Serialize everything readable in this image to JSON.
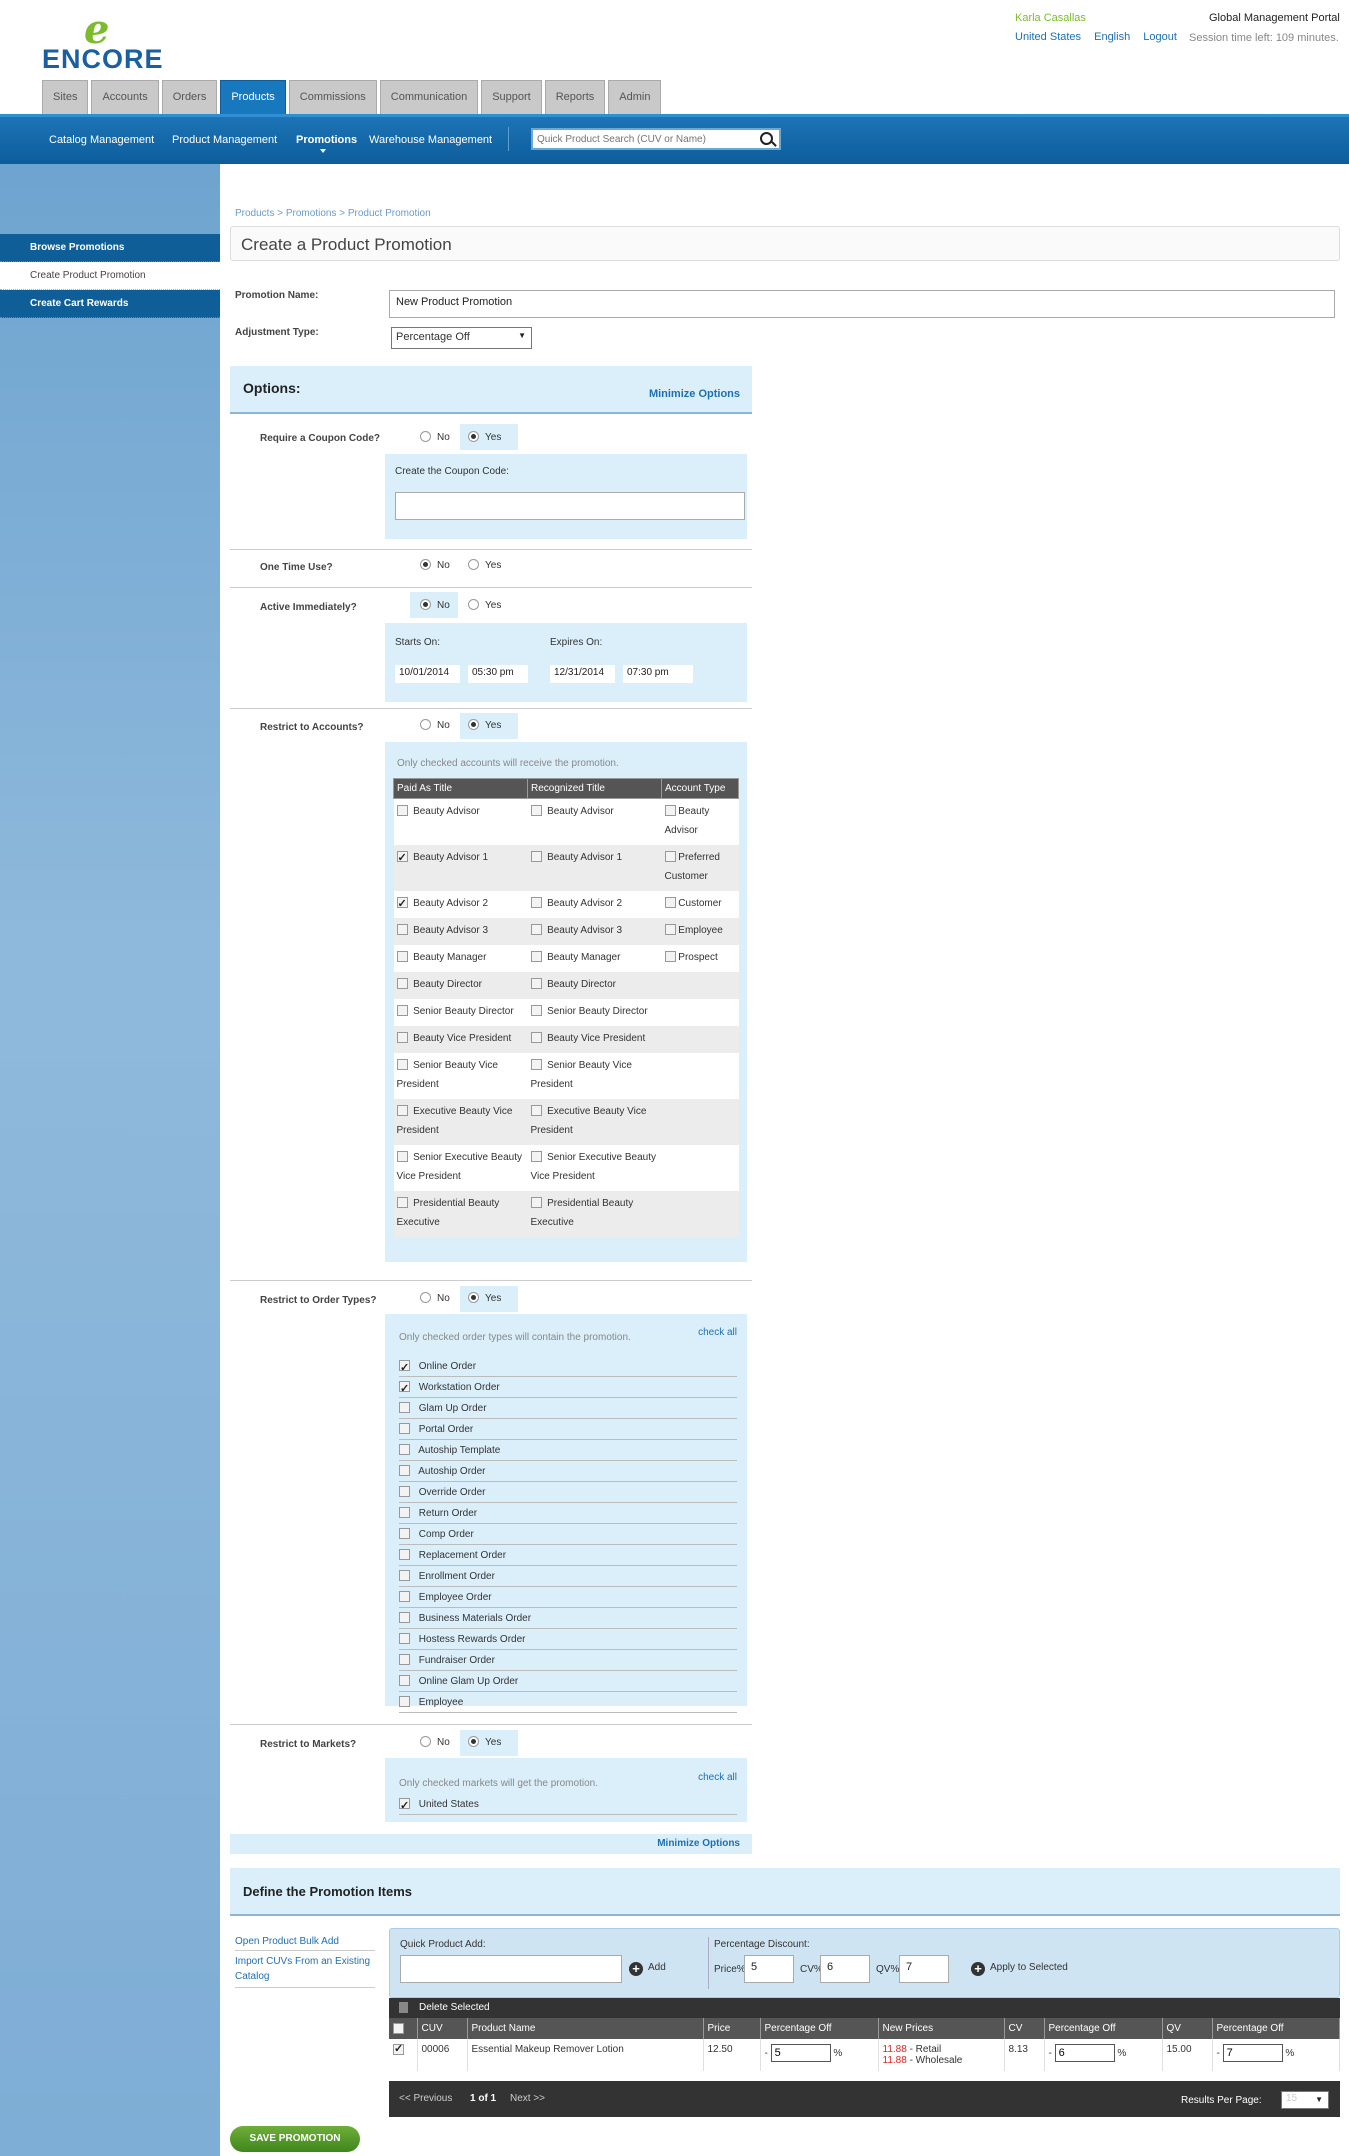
{
  "header": {
    "logo_text": "ENCORE",
    "user_name": "Karla Casallas",
    "portal_name": "Global Management Portal",
    "country_link": "United States",
    "language_link": "English",
    "logout_link": "Logout",
    "session": "Session time left: 109 minutes.",
    "tabs": [
      "Sites",
      "Accounts",
      "Orders",
      "Products",
      "Commissions",
      "Communication",
      "Support",
      "Reports",
      "Admin"
    ]
  },
  "subnav": {
    "items": [
      "Catalog Management",
      "Product Management",
      "Promotions",
      "Warehouse Management"
    ],
    "search_placeholder": "Quick Product Search (CUV or Name)"
  },
  "sidebar": {
    "items": [
      "Browse Promotions",
      "Create Product Promotion",
      "Create Cart Rewards"
    ]
  },
  "page": {
    "breadcrumb": "Products > Promotions > Product Promotion",
    "title": "Create a Product Promotion",
    "promotion_name_label": "Promotion Name:",
    "promotion_name_value": "New Product Promotion",
    "adjustment_type_label": "Adjustment Type:",
    "adjustment_type_value": "Percentage Off"
  },
  "options": {
    "heading": "Options:",
    "minimize": "Minimize Options",
    "no": "No",
    "yes": "Yes",
    "coupon_label": "Require a Coupon Code?",
    "coupon_create_label": "Create the Coupon Code:",
    "one_time_label": "One Time Use?",
    "active_label": "Active Immediately?",
    "starts_label": "Starts On:",
    "expires_label": "Expires On:",
    "start_date": "10/01/2014",
    "start_time": "05:30 pm",
    "end_date": "12/31/2014",
    "end_time": "07:30 pm",
    "accounts_label": "Restrict to Accounts?",
    "accounts_note": "Only checked accounts will receive the promotion.",
    "accounts_headers": [
      "Paid As Title",
      "Recognized Title",
      "Account Type"
    ],
    "paid_titles": [
      "Beauty Advisor",
      "Beauty Advisor 1",
      "Beauty Advisor 2",
      "Beauty Advisor 3",
      "Beauty Manager",
      "Beauty Director",
      "Senior Beauty Director",
      "Beauty Vice President",
      "Senior Beauty Vice President",
      "Executive Beauty Vice President",
      "Senior Executive Beauty Vice President",
      "Presidential Beauty Executive"
    ],
    "paid_checked": [
      false,
      true,
      true,
      false,
      false,
      false,
      false,
      false,
      false,
      false,
      false,
      false
    ],
    "recognized_titles": [
      "Beauty Advisor",
      "Beauty Advisor 1",
      "Beauty Advisor 2",
      "Beauty Advisor 3",
      "Beauty Manager",
      "Beauty Director",
      "Senior Beauty Director",
      "Beauty Vice President",
      "Senior Beauty Vice President",
      "Executive Beauty Vice President",
      "Senior Executive Beauty Vice President",
      "Presidential Beauty Executive"
    ],
    "account_types": [
      "Beauty Advisor",
      "Preferred Customer",
      "Customer",
      "Employee",
      "Prospect"
    ],
    "order_types_label": "Restrict to Order Types?",
    "order_types_note": "Only checked order types will contain the promotion.",
    "check_all": "check all",
    "order_types": [
      "Online Order",
      "Workstation Order",
      "Glam Up Order",
      "Portal Order",
      "Autoship Template",
      "Autoship Order",
      "Override Order",
      "Return Order",
      "Comp Order",
      "Replacement Order",
      "Enrollment Order",
      "Employee Order",
      "Business Materials Order",
      "Hostess Rewards Order",
      "Fundraiser Order",
      "Online Glam Up Order",
      "Employee"
    ],
    "order_types_checked": [
      true,
      true,
      false,
      false,
      false,
      false,
      false,
      false,
      false,
      false,
      false,
      false,
      false,
      false,
      false,
      false,
      false
    ],
    "markets_label": "Restrict to Markets?",
    "markets_note": "Only checked markets will get the promotion.",
    "markets": [
      "United States"
    ]
  },
  "define": {
    "heading": "Define the Promotion Items",
    "bulk_add": "Open Product Bulk Add",
    "import_cuvs": "Import CUVs From an Existing Catalog",
    "quick_add_label": "Quick Product Add:",
    "add_label": "Add",
    "pct_discount_label": "Percentage Discount:",
    "price_pct_label": "Price%",
    "price_pct": "5",
    "cv_pct_label": "CV%",
    "cv_pct": "6",
    "qv_pct_label": "QV%",
    "qv_pct": "7",
    "apply_label": "Apply to Selected",
    "delete_selected": "Delete Selected",
    "columns": [
      "CUV",
      "Product Name",
      "Price",
      "Percentage Off",
      "New Prices",
      "CV",
      "Percentage Off",
      "QV",
      "Percentage Off"
    ],
    "row": {
      "cuv": "00006",
      "name": "Essential Makeup Remover Lotion",
      "price": "12.50",
      "price_off": "5",
      "new_retail": "11.88",
      "retail_label": " - Retail",
      "new_wholesale": "11.88",
      "wholesale_label": " - Wholesale",
      "cv": "8.13",
      "cv_off": "6",
      "qv": "15.00",
      "qv_off": "7"
    },
    "pager_prev": "<< Previous",
    "pager_page": "1 of 1",
    "pager_next": "Next >>",
    "results_label": "Results Per Page:",
    "results_value": "15"
  },
  "save_button": "SAVE PROMOTION"
}
